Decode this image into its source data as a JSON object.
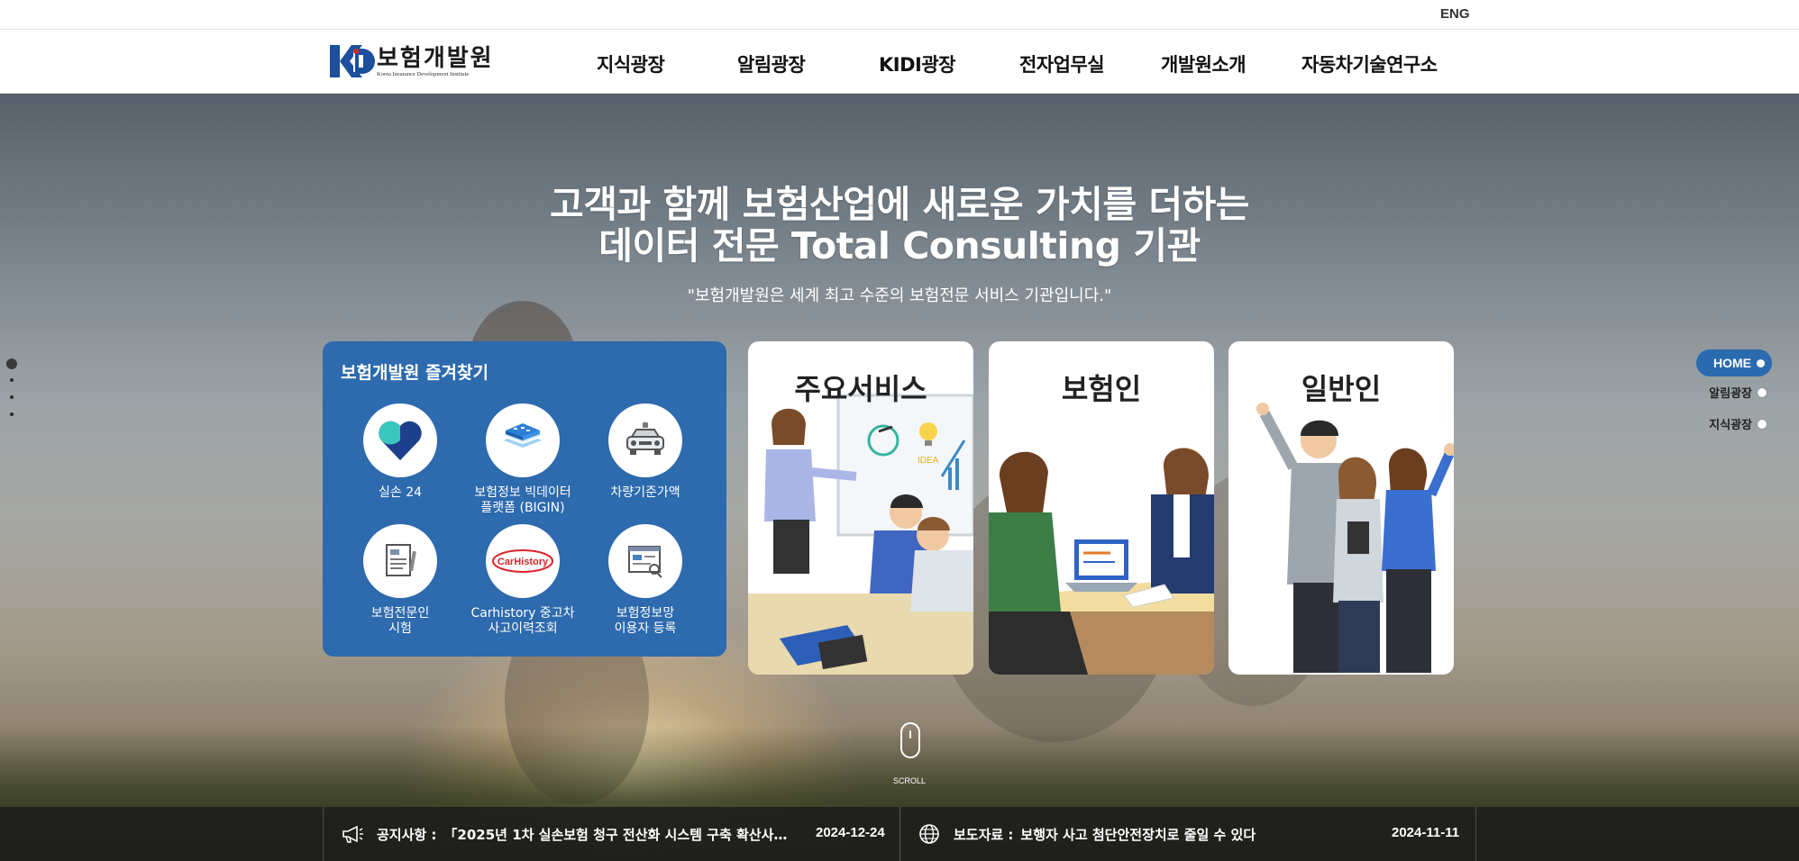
{
  "util": {
    "lang_link": "ENG"
  },
  "header": {
    "logo_ko": "보험개발원",
    "logo_en": "Korea Insurance Development Institute",
    "nav": [
      "지식광장",
      "알림광장",
      "KIDI광장",
      "전자업무실",
      "개발원소개",
      "자동차기술연구소"
    ]
  },
  "hero": {
    "title_line1": "고객과 함께 보험산업에 새로운 가치를 더하는",
    "title_line2": "데이터 전문 Total Consulting 기관",
    "subtitle": "\"보험개발원은 세계 최고 수준의 보험전문 서비스 기관입니다.\""
  },
  "favorites": {
    "title": "보험개발원 즐겨찾기",
    "items": [
      {
        "label": "실손 24",
        "icon": "heart-icon"
      },
      {
        "label": "보험정보 빅데이터\n플랫폼 (BIGIN)",
        "icon": "data-layers-icon"
      },
      {
        "label": "차량기준가액",
        "icon": "car-icon"
      },
      {
        "label": "보험전문인\n시험",
        "icon": "document-icon"
      },
      {
        "label": "Carhistory 중고차\n사고이력조회",
        "icon": "carhistory-logo-icon"
      },
      {
        "label": "보험정보망\n이용자 등록",
        "icon": "register-screen-icon"
      }
    ]
  },
  "cards": [
    {
      "title": "주요서비스"
    },
    {
      "title": "보험인"
    },
    {
      "title": "일반인"
    }
  ],
  "right_nav": {
    "home": "HOME",
    "items": [
      "알림광장",
      "지식광장"
    ]
  },
  "scroll": {
    "label": "SCROLL"
  },
  "news": {
    "notice_label": "공지사항 :",
    "notice_text": "「2025년 1차 실손보험 청구 전산화 시스템 구축 확산사업…",
    "notice_date": "2024-12-24",
    "press_label": "보도자료 :",
    "press_text": "보행자 사고 첨단안전장치로 줄일 수 있다",
    "press_date": "2024-11-11"
  },
  "colors": {
    "brand_blue": "#2d6aae",
    "nav_active": "#2a6bb0"
  }
}
